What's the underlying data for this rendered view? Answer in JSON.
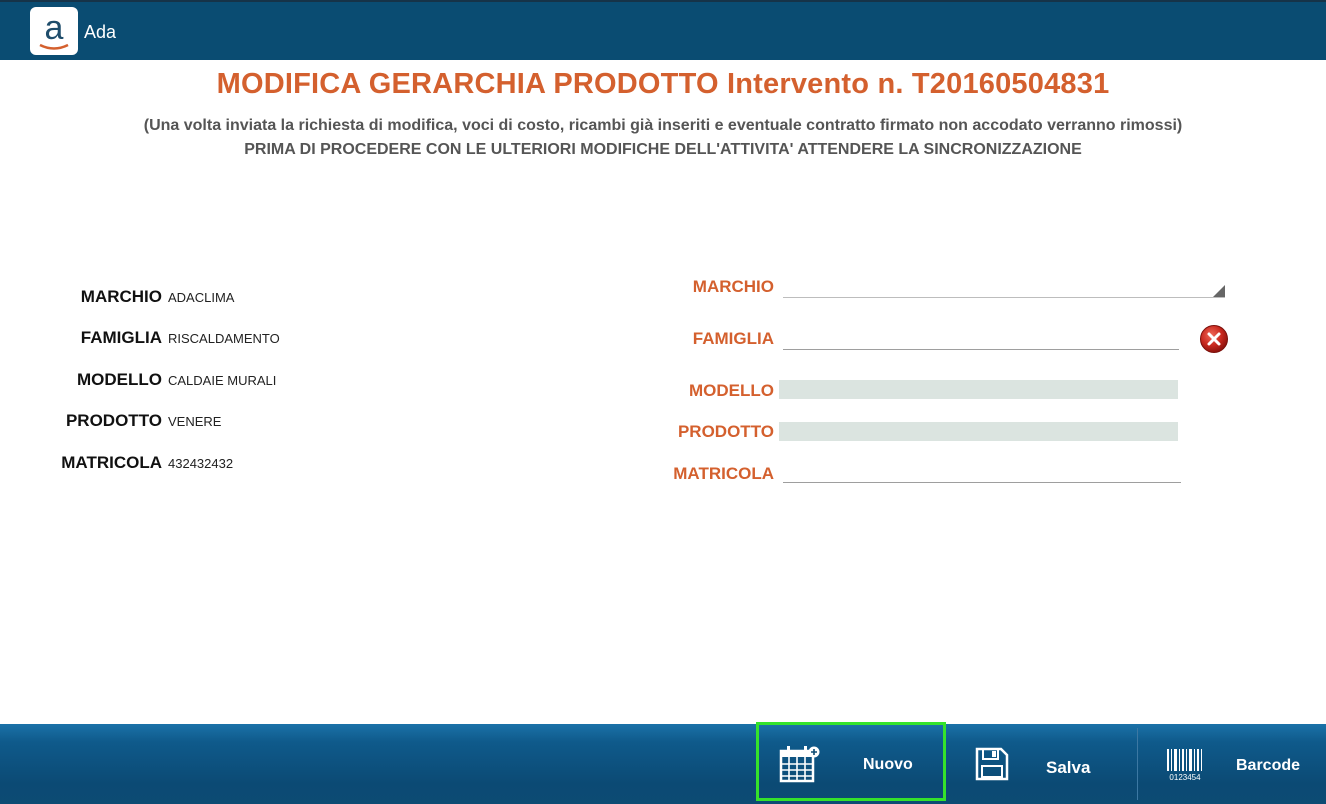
{
  "app": {
    "title": "Ada",
    "logo_letter": "a"
  },
  "header": {
    "title": "MODIFICA GERARCHIA PRODOTTO Intervento n.  T20160504831",
    "subtitle": "(Una volta inviata la richiesta di modifica, voci di costo, ricambi già inseriti e eventuale contratto firmato non accodato verranno rimossi)",
    "notice": "PRIMA DI PROCEDERE CON LE ULTERIORI MODIFICHE DELL'ATTIVITA' ATTENDERE LA SINCRONIZZAZIONE"
  },
  "current": [
    {
      "label": "MARCHIO",
      "value": "ADACLIMA"
    },
    {
      "label": "FAMIGLIA",
      "value": "RISCALDAMENTO"
    },
    {
      "label": "MODELLO",
      "value": "CALDAIE MURALI"
    },
    {
      "label": "PRODOTTO",
      "value": "VENERE"
    },
    {
      "label": "MATRICOLA",
      "value": "432432432"
    }
  ],
  "form": {
    "marchio": {
      "label": "MARCHIO",
      "value": ""
    },
    "famiglia": {
      "label": "FAMIGLIA",
      "value": ""
    },
    "modello": {
      "label": "MODELLO"
    },
    "prodotto": {
      "label": "PRODOTTO"
    },
    "matricola": {
      "label": "MATRICOLA",
      "value": ""
    }
  },
  "toolbar": {
    "nuovo": {
      "label": "Nuovo",
      "icon": "calendar-add-icon"
    },
    "salva": {
      "label": "Salva",
      "icon": "floppy-disk-icon"
    },
    "barcode": {
      "label": "Barcode",
      "icon": "barcode-icon",
      "icon_text": "0123454"
    }
  },
  "colors": {
    "topbar": "#0a4c72",
    "accent": "#d4602e",
    "selected_outline": "#35e22b",
    "disabled_field": "#dbe4e0"
  }
}
